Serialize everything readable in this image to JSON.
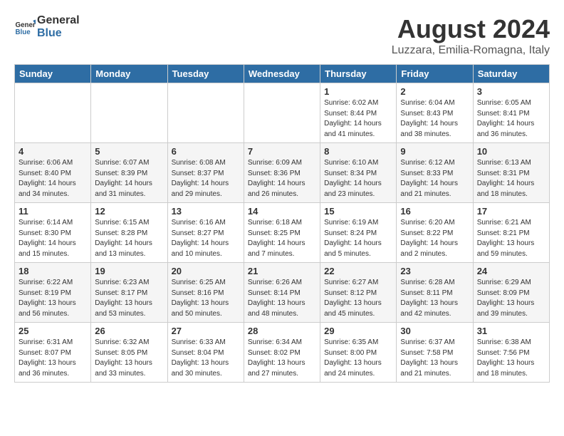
{
  "header": {
    "logo_general": "General",
    "logo_blue": "Blue",
    "title": "August 2024",
    "location": "Luzzara, Emilia-Romagna, Italy"
  },
  "days_of_week": [
    "Sunday",
    "Monday",
    "Tuesday",
    "Wednesday",
    "Thursday",
    "Friday",
    "Saturday"
  ],
  "weeks": [
    [
      {
        "day": "",
        "info": ""
      },
      {
        "day": "",
        "info": ""
      },
      {
        "day": "",
        "info": ""
      },
      {
        "day": "",
        "info": ""
      },
      {
        "day": "1",
        "info": "Sunrise: 6:02 AM\nSunset: 8:44 PM\nDaylight: 14 hours\nand 41 minutes."
      },
      {
        "day": "2",
        "info": "Sunrise: 6:04 AM\nSunset: 8:43 PM\nDaylight: 14 hours\nand 38 minutes."
      },
      {
        "day": "3",
        "info": "Sunrise: 6:05 AM\nSunset: 8:41 PM\nDaylight: 14 hours\nand 36 minutes."
      }
    ],
    [
      {
        "day": "4",
        "info": "Sunrise: 6:06 AM\nSunset: 8:40 PM\nDaylight: 14 hours\nand 34 minutes."
      },
      {
        "day": "5",
        "info": "Sunrise: 6:07 AM\nSunset: 8:39 PM\nDaylight: 14 hours\nand 31 minutes."
      },
      {
        "day": "6",
        "info": "Sunrise: 6:08 AM\nSunset: 8:37 PM\nDaylight: 14 hours\nand 29 minutes."
      },
      {
        "day": "7",
        "info": "Sunrise: 6:09 AM\nSunset: 8:36 PM\nDaylight: 14 hours\nand 26 minutes."
      },
      {
        "day": "8",
        "info": "Sunrise: 6:10 AM\nSunset: 8:34 PM\nDaylight: 14 hours\nand 23 minutes."
      },
      {
        "day": "9",
        "info": "Sunrise: 6:12 AM\nSunset: 8:33 PM\nDaylight: 14 hours\nand 21 minutes."
      },
      {
        "day": "10",
        "info": "Sunrise: 6:13 AM\nSunset: 8:31 PM\nDaylight: 14 hours\nand 18 minutes."
      }
    ],
    [
      {
        "day": "11",
        "info": "Sunrise: 6:14 AM\nSunset: 8:30 PM\nDaylight: 14 hours\nand 15 minutes."
      },
      {
        "day": "12",
        "info": "Sunrise: 6:15 AM\nSunset: 8:28 PM\nDaylight: 14 hours\nand 13 minutes."
      },
      {
        "day": "13",
        "info": "Sunrise: 6:16 AM\nSunset: 8:27 PM\nDaylight: 14 hours\nand 10 minutes."
      },
      {
        "day": "14",
        "info": "Sunrise: 6:18 AM\nSunset: 8:25 PM\nDaylight: 14 hours\nand 7 minutes."
      },
      {
        "day": "15",
        "info": "Sunrise: 6:19 AM\nSunset: 8:24 PM\nDaylight: 14 hours\nand 5 minutes."
      },
      {
        "day": "16",
        "info": "Sunrise: 6:20 AM\nSunset: 8:22 PM\nDaylight: 14 hours\nand 2 minutes."
      },
      {
        "day": "17",
        "info": "Sunrise: 6:21 AM\nSunset: 8:21 PM\nDaylight: 13 hours\nand 59 minutes."
      }
    ],
    [
      {
        "day": "18",
        "info": "Sunrise: 6:22 AM\nSunset: 8:19 PM\nDaylight: 13 hours\nand 56 minutes."
      },
      {
        "day": "19",
        "info": "Sunrise: 6:23 AM\nSunset: 8:17 PM\nDaylight: 13 hours\nand 53 minutes."
      },
      {
        "day": "20",
        "info": "Sunrise: 6:25 AM\nSunset: 8:16 PM\nDaylight: 13 hours\nand 50 minutes."
      },
      {
        "day": "21",
        "info": "Sunrise: 6:26 AM\nSunset: 8:14 PM\nDaylight: 13 hours\nand 48 minutes."
      },
      {
        "day": "22",
        "info": "Sunrise: 6:27 AM\nSunset: 8:12 PM\nDaylight: 13 hours\nand 45 minutes."
      },
      {
        "day": "23",
        "info": "Sunrise: 6:28 AM\nSunset: 8:11 PM\nDaylight: 13 hours\nand 42 minutes."
      },
      {
        "day": "24",
        "info": "Sunrise: 6:29 AM\nSunset: 8:09 PM\nDaylight: 13 hours\nand 39 minutes."
      }
    ],
    [
      {
        "day": "25",
        "info": "Sunrise: 6:31 AM\nSunset: 8:07 PM\nDaylight: 13 hours\nand 36 minutes."
      },
      {
        "day": "26",
        "info": "Sunrise: 6:32 AM\nSunset: 8:05 PM\nDaylight: 13 hours\nand 33 minutes."
      },
      {
        "day": "27",
        "info": "Sunrise: 6:33 AM\nSunset: 8:04 PM\nDaylight: 13 hours\nand 30 minutes."
      },
      {
        "day": "28",
        "info": "Sunrise: 6:34 AM\nSunset: 8:02 PM\nDaylight: 13 hours\nand 27 minutes."
      },
      {
        "day": "29",
        "info": "Sunrise: 6:35 AM\nSunset: 8:00 PM\nDaylight: 13 hours\nand 24 minutes."
      },
      {
        "day": "30",
        "info": "Sunrise: 6:37 AM\nSunset: 7:58 PM\nDaylight: 13 hours\nand 21 minutes."
      },
      {
        "day": "31",
        "info": "Sunrise: 6:38 AM\nSunset: 7:56 PM\nDaylight: 13 hours\nand 18 minutes."
      }
    ]
  ]
}
